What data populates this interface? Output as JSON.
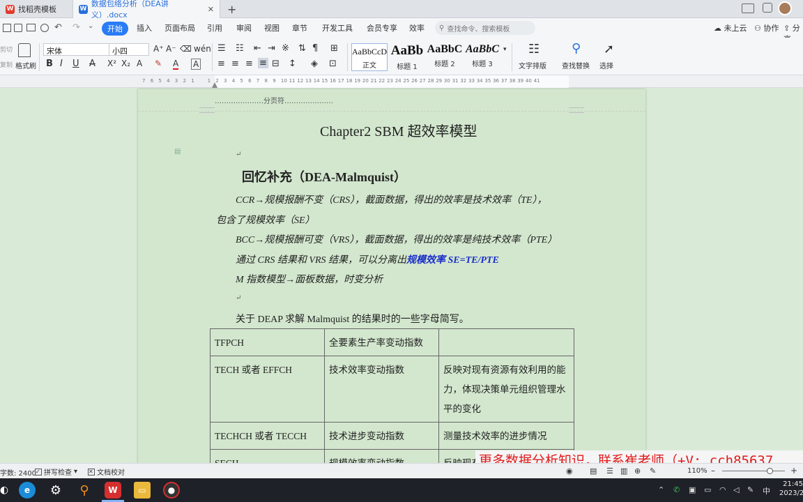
{
  "tabs": [
    {
      "label": "找稻壳模板",
      "icon": "wps-logo-icon"
    },
    {
      "label": "数据包络分析（DEA讲义）.docx",
      "icon": "word-doc-icon"
    }
  ],
  "menu": {
    "items": [
      "开始",
      "插入",
      "页面布局",
      "引用",
      "审阅",
      "视图",
      "章节",
      "开发工具",
      "会员专享",
      "效率"
    ],
    "active": "开始",
    "search_placeholder": "查找命令、搜索模板",
    "cloud": "未上云",
    "collab": "协作",
    "share": "分享"
  },
  "ribbon": {
    "cut": "剪切",
    "copy": "复制",
    "format_painter": "格式刷",
    "font_name": "宋体",
    "font_size": "小四",
    "styles": [
      {
        "preview": "AaBbCcDd",
        "label": "正文"
      },
      {
        "preview": "AaBb",
        "label": "标题 1"
      },
      {
        "preview": "AaBbC",
        "label": "标题 2"
      },
      {
        "preview": "AaBbC",
        "label": "标题 3"
      }
    ],
    "text_layout": "文字排版",
    "find_replace": "查找替换",
    "select": "选择"
  },
  "ruler_numbers": [
    "7",
    "6",
    "5",
    "4",
    "3",
    "2",
    "1",
    "",
    "1",
    "2",
    "3",
    "4",
    "5",
    "6",
    "7",
    "8",
    "9",
    "10",
    "11",
    "12",
    "13",
    "14",
    "15",
    "16",
    "17",
    "18",
    "19",
    "20",
    "21",
    "22",
    "23",
    "24",
    "25",
    "26",
    "27",
    "28",
    "29",
    "30",
    "31",
    "32",
    "33",
    "34",
    "35",
    "36",
    "37",
    "38",
    "39",
    "40",
    "41"
  ],
  "document": {
    "page_break": "…………………分页符…………………",
    "chapter_title": "Chapter2 SBM 超效率模型",
    "section_title": "回忆补充（DEA-Malmquist）",
    "paragraphs": [
      "CCR→规模报酬不变（CRS），截面数据，得出的效率是技术效率（TE），",
      "包含了规模效率（SE）",
      "BCC→规模报酬可变（VRS），截面数据，得出的效率是纯技术效率（PTE）",
      "通过 CRS 结果和 VRS 结果，可以分离出",
      "M 指数模型→面板数据，时变分析"
    ],
    "highlight": "规模效率 SE=TE/PTE",
    "intro": "关于 DEAP 求解 Malmquist 的结果时的一些字母简写。",
    "table": [
      [
        "TFPCH",
        "全要素生产率变动指数",
        ""
      ],
      [
        "TECH 或者 EFFCH",
        "技术效率变动指数",
        "反映对现有资源有效利用的能力，体现决策单元组织管理水平的变化"
      ],
      [
        "TECHCH 或者 TECCH",
        "技术进步变动指数",
        "测量技术效率的进步情况"
      ],
      [
        "SECH",
        "规模效率变动指数",
        "反映现有规模与最优规模的差异"
      ]
    ]
  },
  "status": {
    "word_count": "字数: 2400",
    "spell_check": "拼写检查",
    "doc_check": "文档校对",
    "zoom": "110%"
  },
  "watermark": "更多数据分析知识，联系崔老师（+V: cch85637",
  "taskbar": {
    "time": "21:45",
    "date": "2023/2",
    "ime": "中"
  },
  "colors": {
    "accent": "#2a7cf6",
    "page_bg": "#d2e7cd",
    "highlight_text": "#1a2ec9",
    "watermark_text": "#e01b1b"
  }
}
